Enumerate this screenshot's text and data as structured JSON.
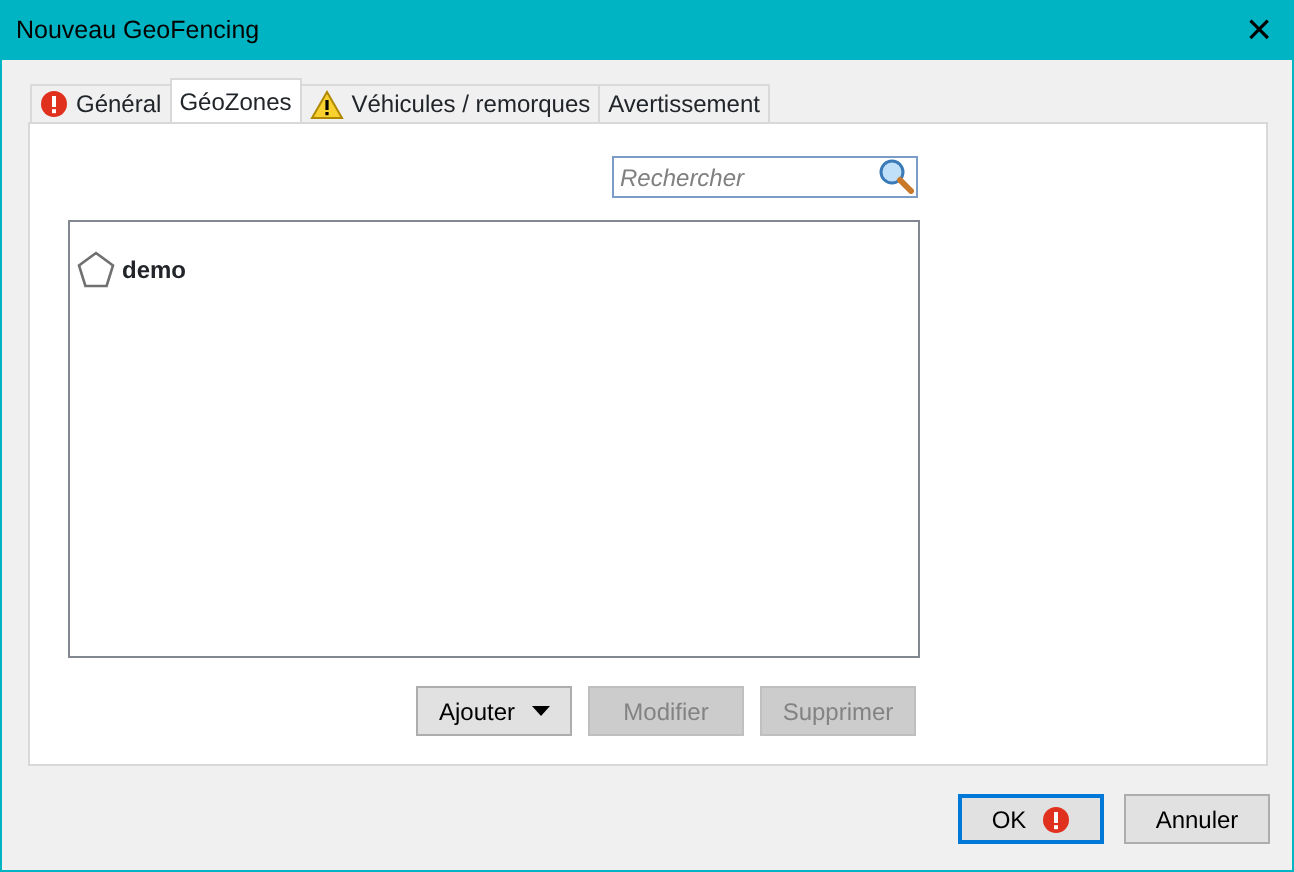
{
  "window": {
    "title": "Nouveau GeoFencing",
    "close": "×"
  },
  "tabs": [
    {
      "label": "Général",
      "selected": false,
      "kind": "error"
    },
    {
      "label": "GéoZones",
      "selected": true,
      "kind": "plain"
    },
    {
      "label": "Véhicules / remorques",
      "selected": false,
      "kind": "warning"
    },
    {
      "label": "Avertissement",
      "selected": false,
      "kind": "plain"
    }
  ],
  "search": {
    "placeholder": "Rechercher"
  },
  "zones": [
    {
      "name": "demo"
    }
  ],
  "list_buttons": [
    {
      "label": "Ajouter",
      "kind": "dropdown",
      "disabled": false
    },
    {
      "label": "Modifier",
      "kind": "plain",
      "disabled": true
    },
    {
      "label": "Supprimer",
      "kind": "plain",
      "disabled": true
    }
  ],
  "dialog_buttons": [
    {
      "label": "OK",
      "kind": "error",
      "focused": true
    },
    {
      "label": "Annuler",
      "kind": "plain",
      "focused": false
    }
  ]
}
